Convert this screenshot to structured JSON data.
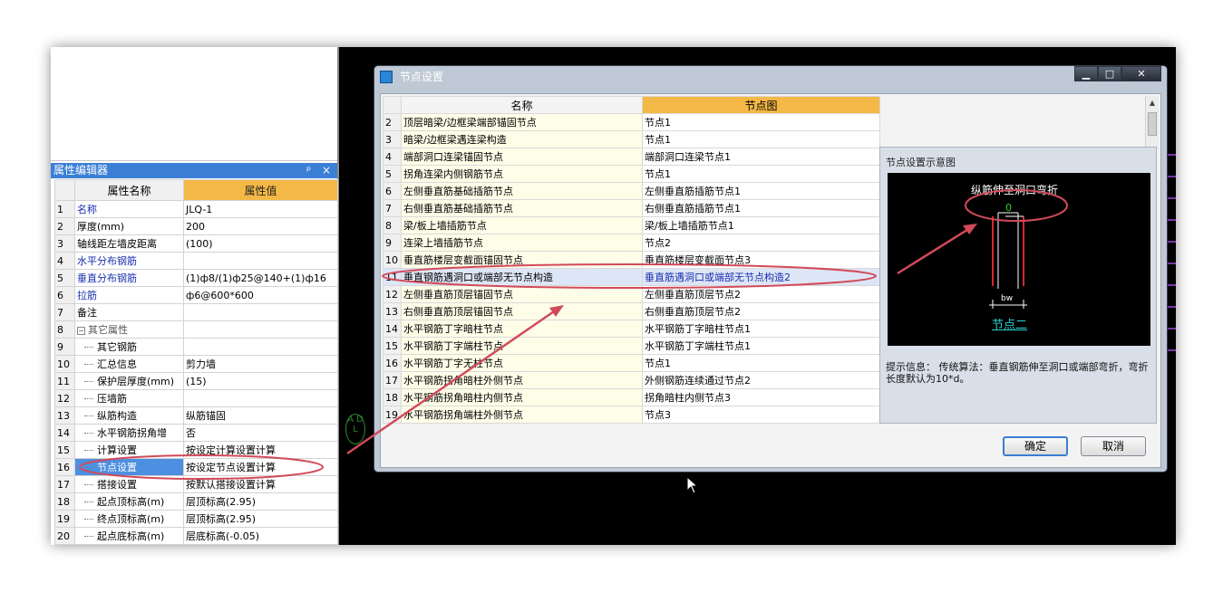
{
  "left_panel": {
    "title": "属性编辑器",
    "title_buttons": "ᵖ ×",
    "header": {
      "name": "属性名称",
      "value": "属性值"
    },
    "rows": [
      {
        "n": "1",
        "name": "名称",
        "value": "JLQ-1",
        "style": "blue"
      },
      {
        "n": "2",
        "name": "厚度(mm)",
        "value": "200",
        "style": ""
      },
      {
        "n": "3",
        "name": "轴线距左墙皮距离",
        "value": "(100)",
        "style": ""
      },
      {
        "n": "4",
        "name": "水平分布钢筋",
        "value": "",
        "style": "blue"
      },
      {
        "n": "5",
        "name": "垂直分布钢筋",
        "value": "(1)ф8/(1)ф25@140+(1)ф16",
        "style": "blue"
      },
      {
        "n": "6",
        "name": "拉筋",
        "value": "ф6@600*600",
        "style": "blue"
      },
      {
        "n": "7",
        "name": "备注",
        "value": "",
        "style": ""
      },
      {
        "n": "8",
        "name": "其它属性",
        "value": "",
        "style": "group"
      },
      {
        "n": "9",
        "name": "其它钢筋",
        "value": "",
        "style": "indent"
      },
      {
        "n": "10",
        "name": "汇总信息",
        "value": "剪力墙",
        "style": "indent"
      },
      {
        "n": "11",
        "name": "保护层厚度(mm)",
        "value": "(15)",
        "style": "indent"
      },
      {
        "n": "12",
        "name": "压墙筋",
        "value": "",
        "style": "indent"
      },
      {
        "n": "13",
        "name": "纵筋构造",
        "value": "纵筋锚固",
        "style": "indent"
      },
      {
        "n": "14",
        "name": "水平钢筋拐角增",
        "value": "否",
        "style": "indent"
      },
      {
        "n": "15",
        "name": "计算设置",
        "value": "按设定计算设置计算",
        "style": "indent"
      },
      {
        "n": "16",
        "name": "节点设置",
        "value": "按设定节点设置计算",
        "style": "indent sel"
      },
      {
        "n": "17",
        "name": "搭接设置",
        "value": "按默认搭接设置计算",
        "style": "indent"
      },
      {
        "n": "18",
        "name": "起点顶标高(m)",
        "value": "层顶标高(2.95)",
        "style": "indent"
      },
      {
        "n": "19",
        "name": "终点顶标高(m)",
        "value": "层顶标高(2.95)",
        "style": "indent"
      },
      {
        "n": "20",
        "name": "起点底标高(m)",
        "value": "层底标高(-0.05)",
        "style": "indent"
      }
    ]
  },
  "canvas": {
    "glyph": "A D L"
  },
  "dialog": {
    "title": "节点设置",
    "buttons": {
      "min": "▁",
      "max": "□",
      "close": "✕"
    },
    "header": {
      "name": "名称",
      "value": "节点图"
    },
    "rows": [
      {
        "n": "2",
        "name": "顶层暗梁/边框梁端部锚固节点",
        "value": "节点1",
        "sel": false
      },
      {
        "n": "3",
        "name": "暗梁/边框梁遇连梁构造",
        "value": "节点1",
        "sel": false
      },
      {
        "n": "4",
        "name": "端部洞口连梁锚固节点",
        "value": "端部洞口连梁节点1",
        "sel": false
      },
      {
        "n": "5",
        "name": "拐角连梁内侧钢筋节点",
        "value": "节点1",
        "sel": false
      },
      {
        "n": "6",
        "name": "左侧垂直筋基础插筋节点",
        "value": "左侧垂直筋插筋节点1",
        "sel": false
      },
      {
        "n": "7",
        "name": "右侧垂直筋基础插筋节点",
        "value": "右侧垂直筋插筋节点1",
        "sel": false
      },
      {
        "n": "8",
        "name": "梁/板上墙插筋节点",
        "value": "梁/板上墙插筋节点1",
        "sel": false
      },
      {
        "n": "9",
        "name": "连梁上墙插筋节点",
        "value": "节点2",
        "sel": false
      },
      {
        "n": "10",
        "name": "垂直筋楼层变截面锚固节点",
        "value": "垂直筋楼层变截面节点3",
        "sel": false
      },
      {
        "n": "11",
        "name": "垂直钢筋遇洞口或端部无节点构造",
        "value": "垂直筋遇洞口或端部无节点构造2",
        "sel": true
      },
      {
        "n": "12",
        "name": "左侧垂直筋顶层锚固节点",
        "value": "左侧垂直筋顶层节点2",
        "sel": false
      },
      {
        "n": "13",
        "name": "右侧垂直筋顶层锚固节点",
        "value": "右侧垂直筋顶层节点2",
        "sel": false
      },
      {
        "n": "14",
        "name": "水平钢筋丁字暗柱节点",
        "value": "水平钢筋丁字暗柱节点1",
        "sel": false
      },
      {
        "n": "15",
        "name": "水平钢筋丁字端柱节点",
        "value": "水平钢筋丁字端柱节点1",
        "sel": false
      },
      {
        "n": "16",
        "name": "水平钢筋丁字无柱节点",
        "value": "节点1",
        "sel": false
      },
      {
        "n": "17",
        "name": "水平钢筋拐角暗柱外侧节点",
        "value": "外侧钢筋连续通过节点2",
        "sel": false
      },
      {
        "n": "18",
        "name": "水平钢筋拐角暗柱内侧节点",
        "value": "拐角暗柱内侧节点3",
        "sel": false
      },
      {
        "n": "19",
        "name": "水平钢筋拐角端柱外侧节点",
        "value": "节点3",
        "sel": false
      }
    ],
    "preview": {
      "title": "节点设置示意图",
      "caption": "纵筋伸至洞口弯折",
      "zero": "0",
      "bw": "bw",
      "node_label": "节点二",
      "hint": "提示信息： 传统算法：垂直钢筋伸至洞口或端部弯折，弯折长度默认为10*d。"
    },
    "ok": "确定",
    "cancel": "取消"
  },
  "colors": {
    "accent": "#f4b847",
    "selection": "#4d8fe0",
    "annotation": "#d24a5a"
  }
}
